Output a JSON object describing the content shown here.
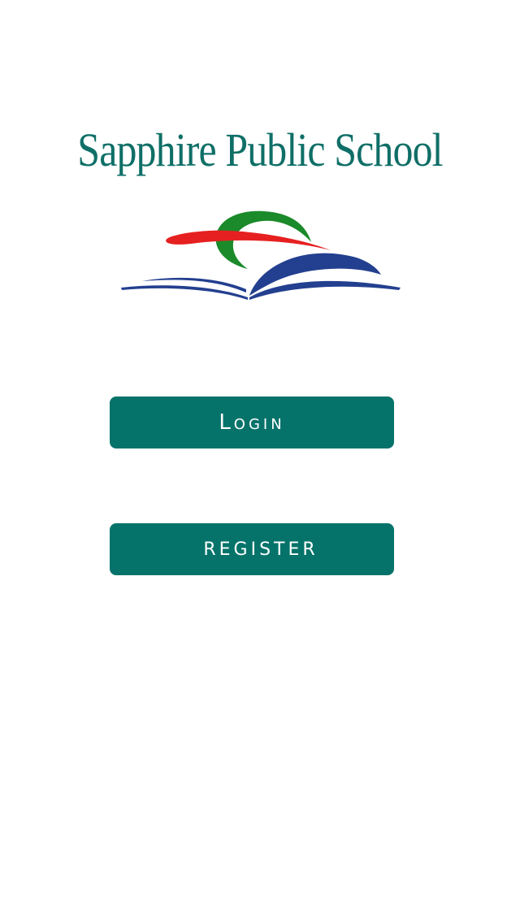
{
  "app": {
    "title": "Sapphire Public School",
    "logo_icon": "open-book-with-swoosh-icon"
  },
  "actions": {
    "login_label": "Login",
    "register_label": "register"
  },
  "colors": {
    "primary": "#06736a",
    "title": "#0f6f67",
    "logo_green": "#1b8a2a",
    "logo_red": "#e62020",
    "logo_blue": "#233f8f",
    "background": "#ffffff"
  }
}
